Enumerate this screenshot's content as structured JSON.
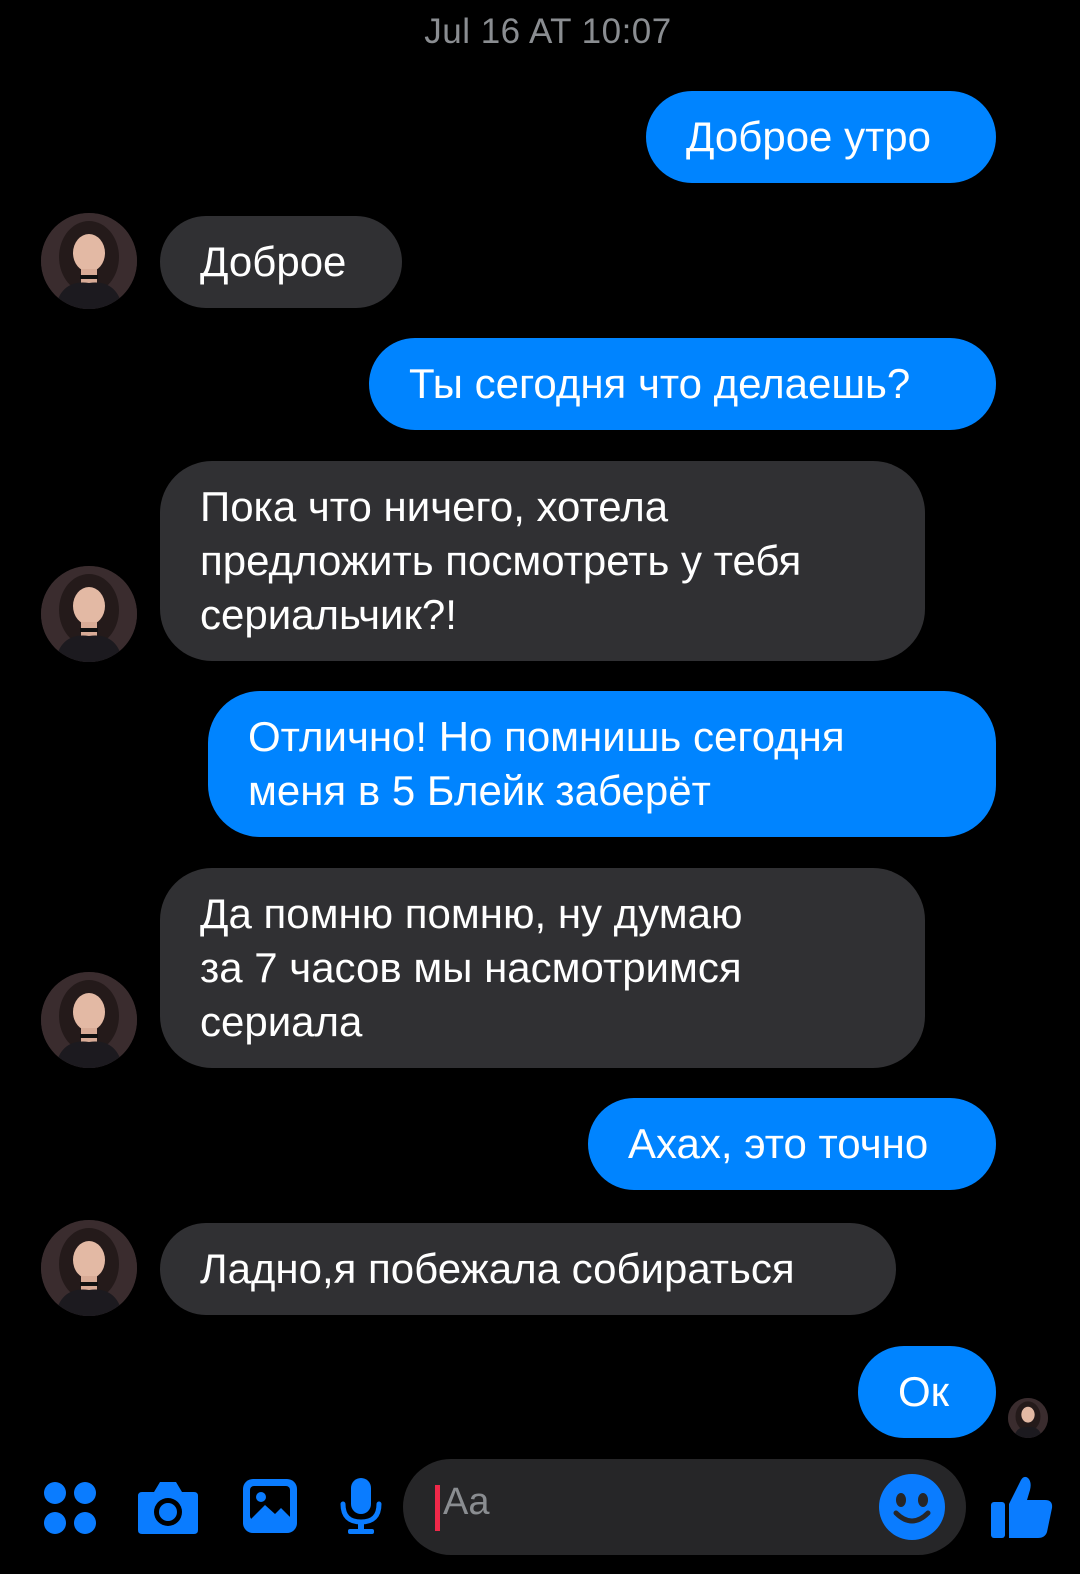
{
  "conversation": {
    "timestamp": "Jul 16 AT 10:07",
    "messages": [
      {
        "from": "me",
        "text": "Доброе утро"
      },
      {
        "from": "contact",
        "text": "Доброе"
      },
      {
        "from": "me",
        "text": "Ты сегодня что делаешь?"
      },
      {
        "from": "contact",
        "text": "Пока что ничего, хотела\nпредложить посмотреть у тебя\nсериальчик?!"
      },
      {
        "from": "me",
        "text": "Отлично! Но помнишь сегодня\nменя в 5 Блейк заберёт"
      },
      {
        "from": "contact",
        "text": "Да помню помню, ну думаю\nза 7 часов мы насмотримся\nсериала"
      },
      {
        "from": "me",
        "text": "Ахах, это точно"
      },
      {
        "from": "contact",
        "text": "Ладно,я побежала собираться"
      },
      {
        "from": "me",
        "text": "Ок"
      }
    ]
  },
  "composer": {
    "placeholder": "Aa",
    "icons": [
      "menu-dots-icon",
      "camera-icon",
      "gallery-icon",
      "microphone-icon",
      "emoji-icon",
      "thumbs-up-icon"
    ]
  },
  "colors": {
    "background": "#000000",
    "outgoing_bubble": "#0084ff",
    "incoming_bubble": "#303033",
    "accent": "#0a7cff",
    "timestamp": "#8a8d91"
  }
}
